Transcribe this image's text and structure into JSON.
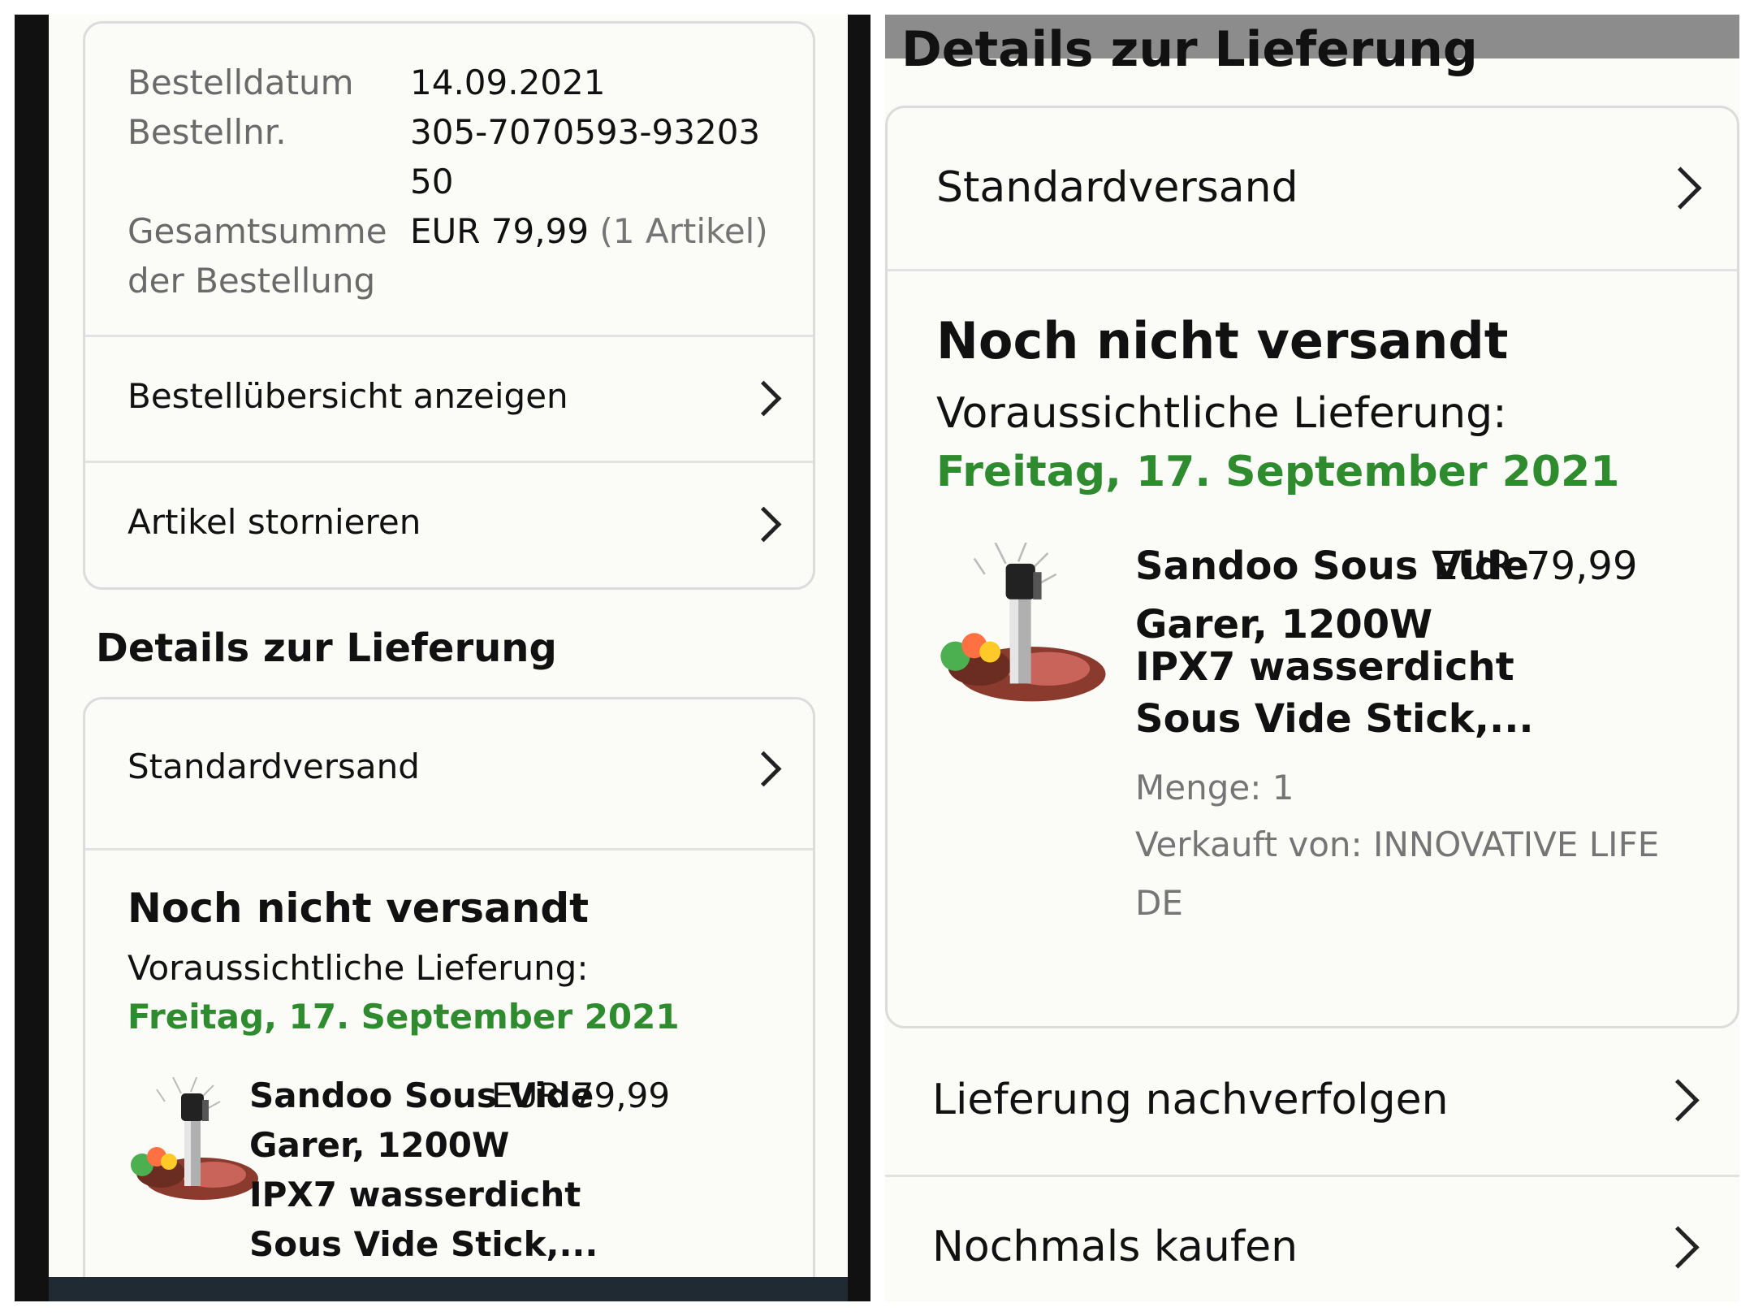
{
  "order_summary": {
    "date_label": "Bestelldatum",
    "date_value": "14.09.2021",
    "number_label": "Bestellnr.",
    "number_value_line1": "305-7070593-93203",
    "number_value_line2": "50",
    "total_label_line1": "Gesamtsumme",
    "total_label_line2": "der Bestellung",
    "total_value": "EUR 79,99",
    "total_items": "(1 Artikel)"
  },
  "actions": {
    "view_summary": "Bestellübersicht anzeigen",
    "cancel_items": "Artikel stornieren"
  },
  "delivery": {
    "section_title": "Details zur Lieferung",
    "shipping_method": "Standardversand",
    "status": "Noch nicht versandt",
    "expected_label": "Voraussichtliche Lieferung:",
    "expected_date": "Freitag, 17. September 2021",
    "product": {
      "title_line1": "Sandoo Sous Vide",
      "title_line2": "Garer, 1200W",
      "title_line3": "IPX7 wasserdicht",
      "title_line4": "Sous Vide Stick,...",
      "price": "EUR 79,99",
      "quantity": "Menge: 1",
      "seller_line1": "Verkauft von: INNOVATIVE LIFE",
      "seller_line2": "DE"
    },
    "track": "Lieferung nachverfolgen",
    "buy_again": "Nochmals kaufen"
  },
  "colors": {
    "delivery_green": "#2e8b2e",
    "left_border": "#111111"
  },
  "icons": {
    "chevron": "chevron-right-icon",
    "product": "sous-vide-product-image"
  }
}
